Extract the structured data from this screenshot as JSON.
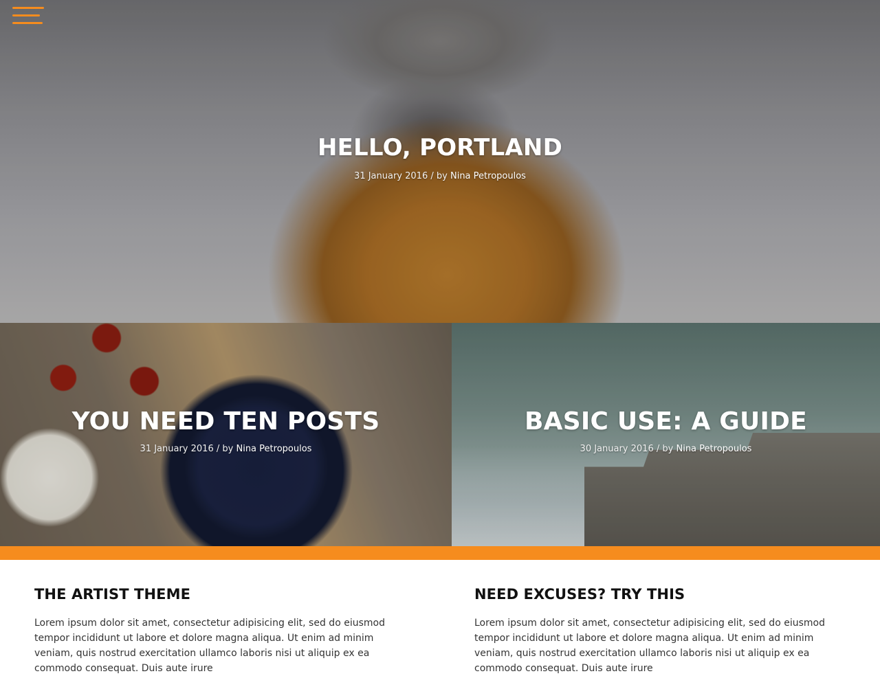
{
  "colors": {
    "accent": "#f68c1e",
    "text_dark": "#111111",
    "body_text": "#333333"
  },
  "menu": {
    "icon": "hamburger-menu-icon"
  },
  "hero": {
    "title": "HELLO, PORTLAND",
    "date": "31 January 2016",
    "separator": "/ by",
    "author": "Nina Petropoulos"
  },
  "posts": [
    {
      "title": "YOU NEED TEN POSTS",
      "date": "31 January 2016",
      "separator": "/ by",
      "author": "Nina Petropoulos"
    },
    {
      "title": "BASIC USE: A GUIDE",
      "date": "30 January 2016",
      "separator": "/ by",
      "author": "Nina Petropoulos"
    }
  ],
  "widgets": [
    {
      "title": "THE ARTIST THEME",
      "text": "Lorem ipsum dolor sit amet, consectetur adipisicing elit, sed do eiusmod tempor incididunt ut labore et dolore magna aliqua. Ut enim ad minim veniam, quis nostrud exercitation ullamco laboris nisi ut aliquip ex ea commodo consequat. Duis aute irure"
    },
    {
      "title": "NEED EXCUSES? TRY THIS",
      "text": "Lorem ipsum dolor sit amet, consectetur adipisicing elit, sed do eiusmod tempor incididunt ut labore et dolore magna aliqua. Ut enim ad minim veniam, quis nostrud exercitation ullamco laboris nisi ut aliquip ex ea commodo consequat. Duis aute irure"
    }
  ]
}
